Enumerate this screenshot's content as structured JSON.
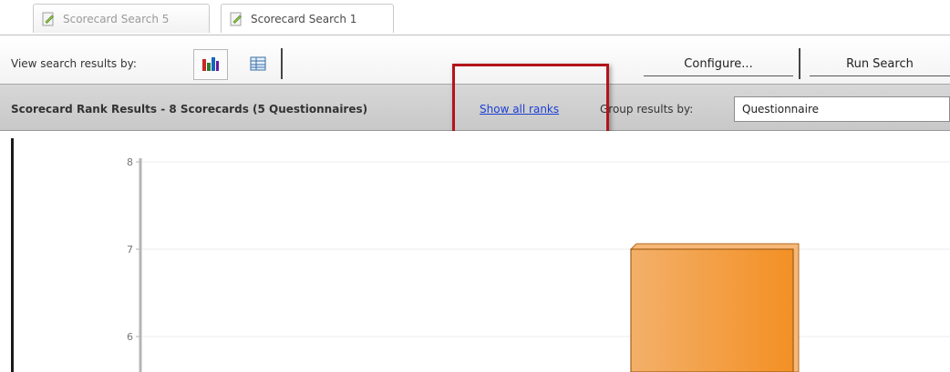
{
  "tabs": [
    {
      "label": "Scorecard Search 5",
      "icon": "document-edit-icon"
    },
    {
      "label": "Scorecard Search 1",
      "icon": "document-edit-icon"
    }
  ],
  "toolbar": {
    "view_label": "View search results by:",
    "configure_label": "Configure...",
    "run_label": "Run Search"
  },
  "results": {
    "title": "Scorecard Rank Results - 8 Scorecards (5 Questionnaires)",
    "show_all_link": "Show all ranks",
    "group_label": "Group results by:",
    "group_value": "Questionnaire"
  },
  "colors": {
    "highlight": "#b3141b",
    "bar": "#f5a04a",
    "link": "#1c3fd4"
  },
  "chart_data": {
    "type": "bar",
    "yticks": [
      "8",
      "7",
      "6"
    ],
    "ylim": [
      5.6,
      8
    ],
    "values": [
      7
    ]
  }
}
